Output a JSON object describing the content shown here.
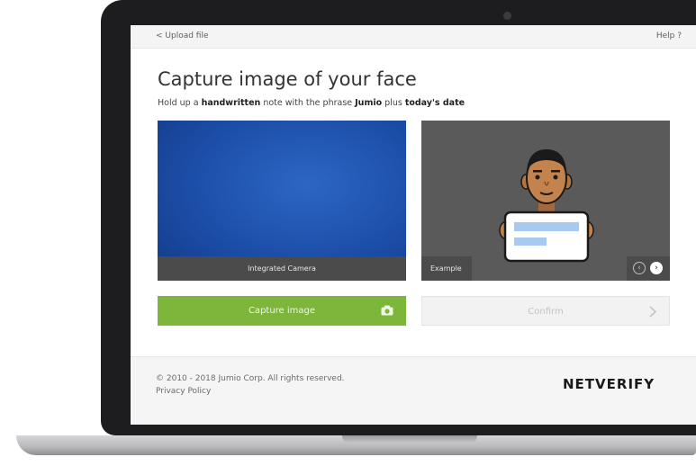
{
  "topbar": {
    "back_label": "< Upload file",
    "help_label": "Help ?"
  },
  "main": {
    "title": "Capture image of your face",
    "instruction": {
      "prefix": "Hold up a ",
      "bold1": "handwritten",
      "middle": " note with the phrase ",
      "bold2": "Jumio",
      "middle2": " plus ",
      "bold3": "today's date"
    }
  },
  "camera_panel": {
    "label": "Integrated Camera"
  },
  "example_panel": {
    "label": "Example",
    "prev_icon": "chevron-left-icon",
    "next_icon": "chevron-right-icon"
  },
  "actions": {
    "capture_label": "Capture image",
    "capture_icon": "camera-icon",
    "confirm_label": "Confirm",
    "confirm_icon": "chevron-right-icon"
  },
  "footer": {
    "copyright": "© 2010 - 2018 Jumio Corp. All rights reserved.",
    "privacy_label": "Privacy Policy"
  },
  "brand": {
    "logo_text": "NETVERIFY"
  },
  "colors": {
    "capture_button": "#7db63a",
    "camera_feed": "#1c4ea8",
    "example_bg": "#5a5a5a",
    "laptop_bezel": "#1d1d1f"
  }
}
